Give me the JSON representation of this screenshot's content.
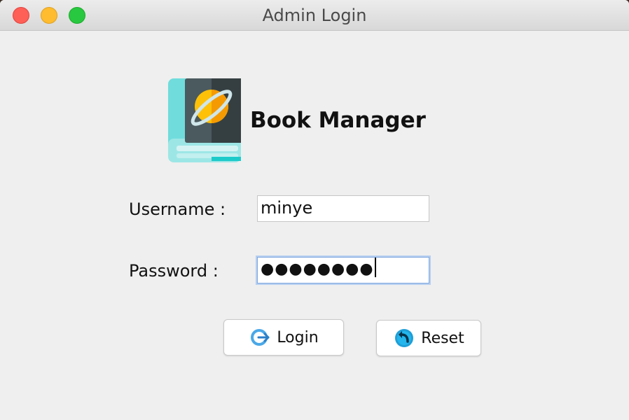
{
  "window": {
    "title": "Admin Login"
  },
  "app": {
    "name": "Book Manager",
    "logo_icon": "book-planet-icon"
  },
  "form": {
    "username_label": "Username :",
    "username_value": "minye",
    "password_label": "Password :",
    "password_masked": "●●●●●●●●"
  },
  "buttons": {
    "login_label": "Login",
    "login_icon": "login-arrow-icon",
    "reset_label": "Reset",
    "reset_icon": "reset-undo-icon"
  },
  "colors": {
    "close": "#fe5f57",
    "minimize": "#febc2e",
    "maximize": "#28c840",
    "focus_ring": "#7ea8e0"
  }
}
